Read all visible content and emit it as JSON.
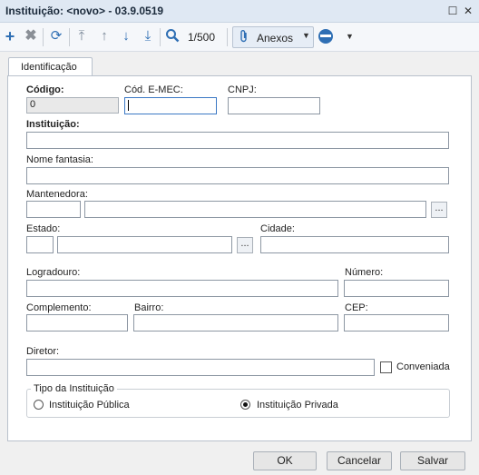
{
  "window": {
    "title": "Instituição: <novo> - 03.9.0519"
  },
  "toolbar": {
    "counter": "1/500",
    "anexos_label": "Anexos"
  },
  "tabs": [
    {
      "label": "Identificação"
    }
  ],
  "form": {
    "codigo_label": "Código:",
    "codigo_value": "0",
    "cod_emec_label": "Cód. E-MEC:",
    "cnpj_label": "CNPJ:",
    "instituicao_label": "Instituição:",
    "nome_fantasia_label": "Nome fantasia:",
    "mantenedora_label": "Mantenedora:",
    "estado_label": "Estado:",
    "cidade_label": "Cidade:",
    "logradouro_label": "Logradouro:",
    "numero_label": "Número:",
    "complemento_label": "Complemento:",
    "bairro_label": "Bairro:",
    "cep_label": "CEP:",
    "diretor_label": "Diretor:",
    "conveniada_label": "Conveniada",
    "ellipsis": "...",
    "tipo_group_label": "Tipo da Instituição",
    "tipo_options": [
      "Instituição Pública",
      "Instituição Privada"
    ],
    "tipo_selected": "Instituição Privada"
  },
  "buttons": {
    "ok": "OK",
    "cancel": "Cancelar",
    "save": "Salvar"
  }
}
